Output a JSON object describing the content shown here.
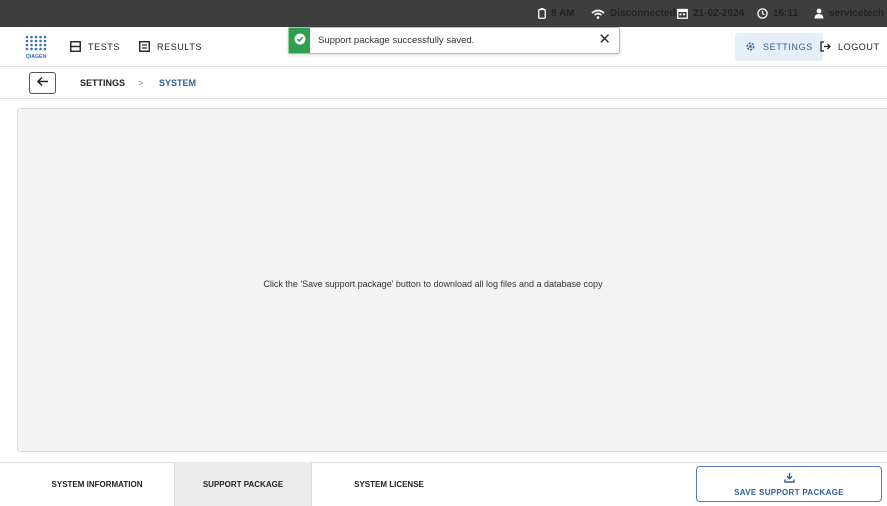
{
  "statusbar": {
    "battery": "8 AM",
    "network": "Disconnected",
    "date": "21-02-2024",
    "time": "16:11",
    "user": "servicetech"
  },
  "navbar": {
    "logo_text": "QIAGEN",
    "tests_label": "TESTS",
    "results_label": "RESULTS",
    "settings_label": "SETTINGS",
    "logout_label": "LOGOUT"
  },
  "toast": {
    "message": "Support package successfully saved.",
    "close_glyph": "✕"
  },
  "breadcrumb": {
    "items": [
      "SETTINGS",
      "SYSTEM"
    ],
    "separator": ">"
  },
  "main": {
    "message": "Click the 'Save support package' button to download all log files and a database copy"
  },
  "tabs": [
    {
      "label": "SYSTEM INFORMATION"
    },
    {
      "label": "SUPPORT PACKAGE",
      "active": true
    },
    {
      "label": "SYSTEM LICENSE"
    }
  ],
  "actions": {
    "save_label": "SAVE SUPPORT PACKAGE"
  },
  "colors": {
    "statusbar_bg": "#3e3e3e",
    "accent": "#2f5f96",
    "success": "#2e9e4f",
    "panel_bg": "#f3f3f3"
  }
}
